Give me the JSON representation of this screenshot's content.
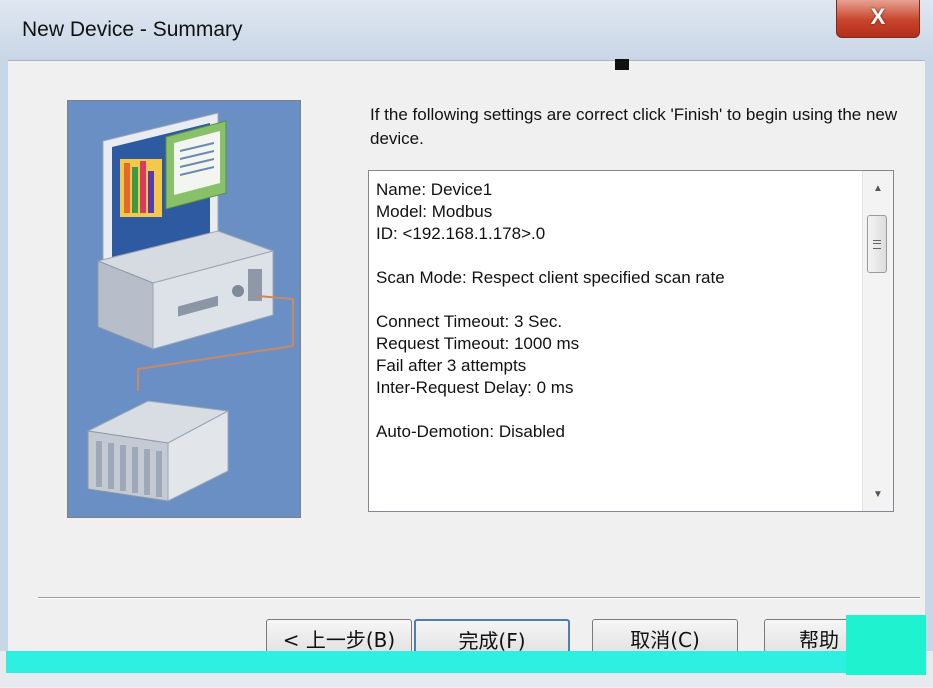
{
  "window": {
    "title": "New Device - Summary",
    "close_label": "X"
  },
  "instructions": "If the following settings are correct click 'Finish' to begin using the new device.",
  "summary": {
    "lines": [
      "Name: Device1",
      "Model: Modbus",
      "ID: <192.168.1.178>.0",
      "",
      "Scan Mode: Respect client specified scan rate",
      "",
      "Connect Timeout: 3 Sec.",
      "Request Timeout: 1000 ms",
      "Fail after 3 attempts",
      "Inter-Request Delay: 0 ms",
      "",
      "Auto-Demotion: Disabled"
    ]
  },
  "buttons": {
    "back": "< 上一步(B)",
    "finish": "完成(F)",
    "cancel": "取消(C)",
    "help": "帮助"
  },
  "icons": {
    "close": "close-icon",
    "scroll_up": "scroll-up-icon",
    "scroll_down": "scroll-down-icon",
    "illustration": "computer-network-plc-illustration"
  }
}
